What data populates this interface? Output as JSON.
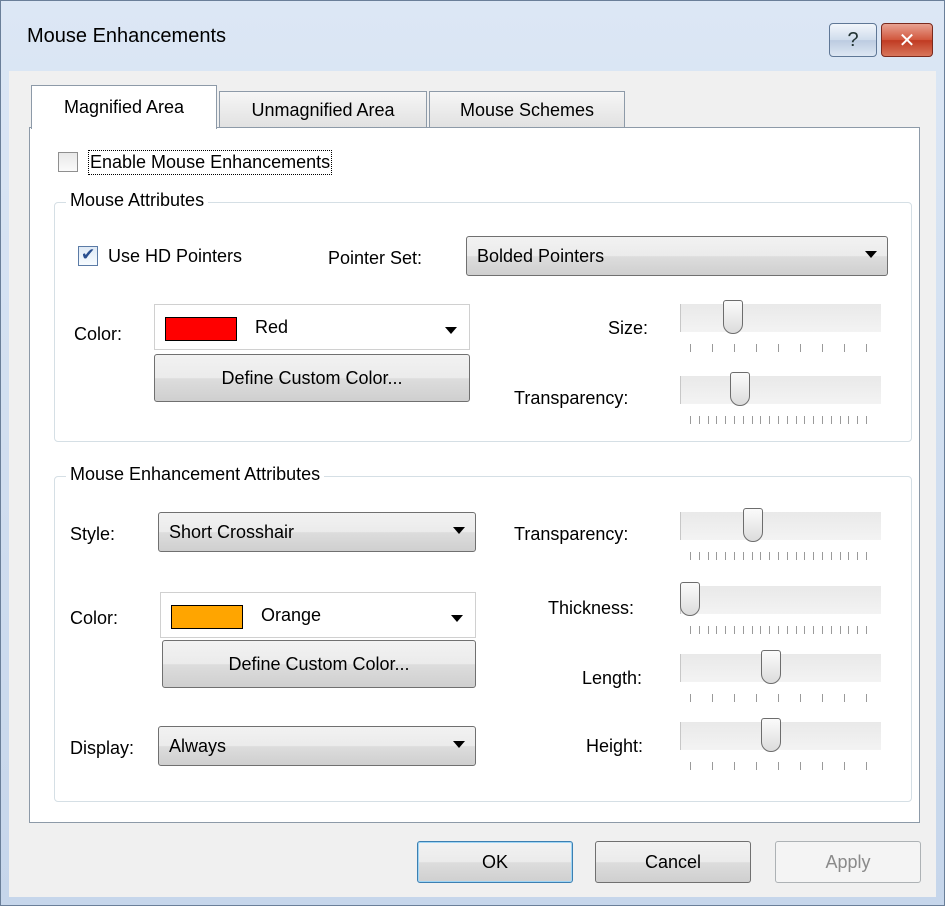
{
  "window": {
    "title": "Mouse Enhancements",
    "help_label": "?",
    "close_label": "✕"
  },
  "tabs": [
    {
      "label": "Magnified Area",
      "active": true
    },
    {
      "label": "Unmagnified Area",
      "active": false
    },
    {
      "label": "Mouse Schemes",
      "active": false
    }
  ],
  "enable": {
    "label": "Enable Mouse Enhancements",
    "checked": false
  },
  "mouse_attributes": {
    "title": "Mouse Attributes",
    "hd_pointers": {
      "label": "Use HD Pointers",
      "checked": true
    },
    "pointer_set": {
      "label": "Pointer Set:",
      "value": "Bolded Pointers"
    },
    "color": {
      "label": "Color:",
      "value": "Red",
      "swatch": "#ff0000"
    },
    "custom_color_button": "Define Custom Color...",
    "size": {
      "label": "Size:",
      "level": 0.24,
      "ticks": 9
    },
    "transparency": {
      "label": "Transparency:",
      "level": 0.28,
      "ticks": 21
    }
  },
  "enhancement_attributes": {
    "title": "Mouse Enhancement Attributes",
    "style": {
      "label": "Style:",
      "value": "Short Crosshair"
    },
    "color": {
      "label": "Color:",
      "value": "Orange",
      "swatch": "#ffa500"
    },
    "custom_color_button": "Define Custom Color...",
    "display": {
      "label": "Display:",
      "value": "Always"
    },
    "transparency": {
      "label": "Transparency:",
      "level": 0.35,
      "ticks": 21
    },
    "thickness": {
      "label": "Thickness:",
      "level": 0.0,
      "ticks": 21
    },
    "length": {
      "label": "Length:",
      "level": 0.45,
      "ticks": 9
    },
    "height": {
      "label": "Height:",
      "level": 0.45,
      "ticks": 9
    }
  },
  "buttons": {
    "ok": "OK",
    "cancel": "Cancel",
    "apply": "Apply"
  }
}
